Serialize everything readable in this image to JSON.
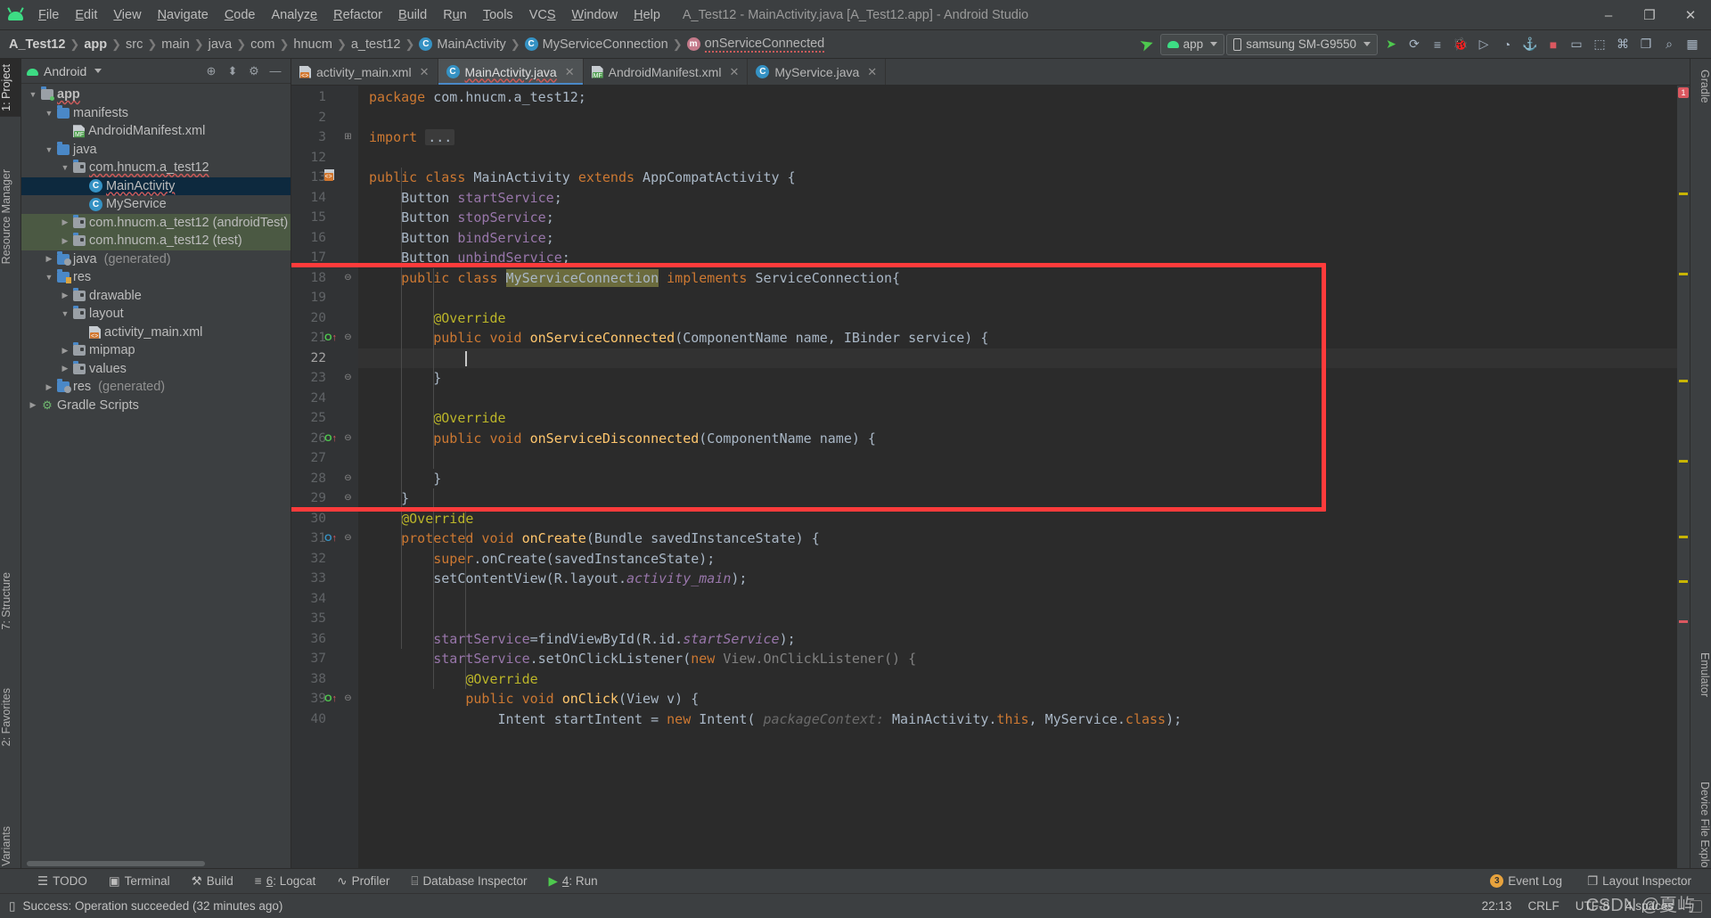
{
  "window": {
    "title": "A_Test12 - MainActivity.java [A_Test12.app] - Android Studio",
    "minimize": "–",
    "maximize": "❐",
    "close": "✕"
  },
  "menubar": {
    "items": [
      "File",
      "Edit",
      "View",
      "Navigate",
      "Code",
      "Analyze",
      "Refactor",
      "Build",
      "Run",
      "Tools",
      "VCS",
      "Window",
      "Help"
    ]
  },
  "breadcrumb": {
    "items": [
      {
        "label": "A_Test12",
        "bold": true,
        "icon": null
      },
      {
        "label": "app",
        "bold": true,
        "icon": null
      },
      {
        "label": "src",
        "bold": false,
        "icon": null
      },
      {
        "label": "main",
        "bold": false,
        "icon": null
      },
      {
        "label": "java",
        "bold": false,
        "icon": null
      },
      {
        "label": "com",
        "bold": false,
        "icon": null
      },
      {
        "label": "hnucm",
        "bold": false,
        "icon": null
      },
      {
        "label": "a_test12",
        "bold": false,
        "icon": null
      },
      {
        "label": "MainActivity",
        "bold": false,
        "icon": "class-badge"
      },
      {
        "label": "MyServiceConnection",
        "bold": false,
        "icon": "class-badge"
      },
      {
        "label": "onServiceConnected",
        "bold": false,
        "icon": "method-badge",
        "error": true
      }
    ],
    "separator": "❯"
  },
  "run_toolbar": {
    "config_label": "app",
    "device_label": "samsung SM-G9550",
    "icons": [
      {
        "name": "run-icon",
        "glyph": "➤"
      },
      {
        "name": "debug-attach-icon",
        "glyph": "⟳"
      },
      {
        "name": "apply-changes-icon",
        "glyph": "≡"
      },
      {
        "name": "debug-icon",
        "glyph": "🐞"
      },
      {
        "name": "run-to-cursor-icon",
        "glyph": "▷"
      },
      {
        "name": "profiler-icon",
        "glyph": "◔"
      },
      {
        "name": "attach-debugger-icon",
        "glyph": "⚓"
      },
      {
        "name": "stop-icon",
        "glyph": "■"
      },
      {
        "name": "avd-manager-icon",
        "glyph": "▭"
      },
      {
        "name": "sdk-manager-icon",
        "glyph": "⬚"
      },
      {
        "name": "device-file-explorer-icon",
        "glyph": "⌘"
      },
      {
        "name": "layout-inspector-icon",
        "glyph": "❐"
      },
      {
        "name": "search-icon",
        "glyph": "⌕"
      },
      {
        "name": "project-structure-icon",
        "glyph": "▦"
      }
    ],
    "sync_icon": "↻"
  },
  "left_tool_tabs": [
    {
      "label": "1: Project",
      "active": true
    },
    {
      "label": "Resource Manager",
      "active": false
    },
    {
      "label": "7: Structure",
      "active": false
    },
    {
      "label": "2: Favorites",
      "active": false
    },
    {
      "label": "Build Variants",
      "active": false
    }
  ],
  "right_tool_tabs": [
    {
      "label": "Gradle"
    },
    {
      "label": "Emulator"
    },
    {
      "label": "Device File Explorer"
    }
  ],
  "project_panel": {
    "scope_label": "Android",
    "header_icons": [
      {
        "name": "locate-icon",
        "glyph": "⊕"
      },
      {
        "name": "collapse-all-icon",
        "glyph": "⬍"
      },
      {
        "name": "settings-gear-icon",
        "glyph": "⚙"
      },
      {
        "name": "hide-panel-icon",
        "glyph": "—"
      }
    ],
    "tree": [
      {
        "label": "app",
        "indent": 0,
        "twist": "▼",
        "icon": "module-folder",
        "bold": true,
        "spell": true
      },
      {
        "label": "manifests",
        "indent": 1,
        "twist": "▼",
        "icon": "folder"
      },
      {
        "label": "AndroidManifest.xml",
        "indent": 2,
        "twist": "",
        "icon": "xml-manifest"
      },
      {
        "label": "java",
        "indent": 1,
        "twist": "▼",
        "icon": "folder"
      },
      {
        "label": "com.hnucm.a_test12",
        "indent": 2,
        "twist": "▼",
        "icon": "package",
        "spell": true
      },
      {
        "label": "MainActivity",
        "indent": 3,
        "twist": "",
        "icon": "class",
        "selected": true,
        "spell": true
      },
      {
        "label": "MyService",
        "indent": 3,
        "twist": "",
        "icon": "class"
      },
      {
        "label": "com.hnucm.a_test12 (androidTest)",
        "indent": 2,
        "twist": "▶",
        "icon": "package",
        "scope": "test"
      },
      {
        "label": "com.hnucm.a_test12 (test)",
        "indent": 2,
        "twist": "▶",
        "icon": "package",
        "scope": "test"
      },
      {
        "label": "java (generated)",
        "indent": 1,
        "twist": "▶",
        "icon": "folder-generated",
        "gray_suffix": "(generated)"
      },
      {
        "label": "res",
        "indent": 1,
        "twist": "▼",
        "icon": "folder-res"
      },
      {
        "label": "drawable",
        "indent": 2,
        "twist": "▶",
        "icon": "package"
      },
      {
        "label": "layout",
        "indent": 2,
        "twist": "▼",
        "icon": "package"
      },
      {
        "label": "activity_main.xml",
        "indent": 3,
        "twist": "",
        "icon": "xml-layout"
      },
      {
        "label": "mipmap",
        "indent": 2,
        "twist": "▶",
        "icon": "package"
      },
      {
        "label": "values",
        "indent": 2,
        "twist": "▶",
        "icon": "package"
      },
      {
        "label": "res (generated)",
        "indent": 1,
        "twist": "▶",
        "icon": "folder-generated",
        "gray_suffix": "(generated)"
      },
      {
        "label": "Gradle Scripts",
        "indent": 0,
        "twist": "▶",
        "icon": "gradle"
      }
    ]
  },
  "editor_tabs": [
    {
      "label": "activity_main.xml",
      "icon": "xml-layout-icon",
      "active": false,
      "close": "✕"
    },
    {
      "label": "MainActivity.java",
      "icon": "class-icon",
      "active": true,
      "close": "✕",
      "error": true
    },
    {
      "label": "AndroidManifest.xml",
      "icon": "xml-manifest-icon",
      "active": false,
      "close": "✕"
    },
    {
      "label": "MyService.java",
      "icon": "class-icon",
      "active": false,
      "close": "✕"
    }
  ],
  "editor": {
    "file": "MainActivity.java",
    "caret_line": 22,
    "error_count_badge": "1",
    "lines": [
      {
        "num": "1",
        "indent": 0,
        "html": "<span class=\"k\">package</span> com.hnucm.a_test12;"
      },
      {
        "num": "2",
        "indent": 0,
        "html": ""
      },
      {
        "num": "3",
        "indent": 0,
        "html": "<span class=\"k\">import</span> <span class=\"folded\">...</span>",
        "fold": "⊞"
      },
      {
        "num": "12",
        "indent": 0,
        "html": ""
      },
      {
        "num": "13",
        "indent": 0,
        "html": "<span class=\"k\">public class</span> MainActivity <span class=\"k\">extends</span> AppCompatActivity {",
        "gmark": "layout"
      },
      {
        "num": "14",
        "indent": 1,
        "html": "    Button <span class=\"fi\">startService</span>;"
      },
      {
        "num": "15",
        "indent": 1,
        "html": "    Button <span class=\"fi\">stopService</span>;"
      },
      {
        "num": "16",
        "indent": 1,
        "html": "    Button <span class=\"fi\">bindService</span>;"
      },
      {
        "num": "17",
        "indent": 1,
        "html": "    Button <span class=\"fi\">unbindService</span>;"
      },
      {
        "num": "18",
        "indent": 1,
        "html": "    <span class=\"k\">public class</span> <span class=\"ident-hl\">MyServiceConnection</span> <span class=\"k\">implements</span> ServiceConnection{",
        "fold": "⊖"
      },
      {
        "num": "19",
        "indent": 1,
        "html": ""
      },
      {
        "num": "20",
        "indent": 2,
        "html": "        <span class=\"an\">@Override</span>"
      },
      {
        "num": "21",
        "indent": 2,
        "html": "        <span class=\"k\">public void</span> <span class=\"f\">onServiceConnected</span>(ComponentName name, IBinder service) {",
        "gmark": "override-green",
        "fold": "⊖"
      },
      {
        "num": "22",
        "indent": 3,
        "html": "",
        "current": true
      },
      {
        "num": "23",
        "indent": 2,
        "html": "        }",
        "fold": "⊖"
      },
      {
        "num": "24",
        "indent": 2,
        "html": ""
      },
      {
        "num": "25",
        "indent": 2,
        "html": "        <span class=\"an\">@Override</span>"
      },
      {
        "num": "26",
        "indent": 2,
        "html": "        <span class=\"k\">public void</span> <span class=\"f\">onServiceDisconnected</span>(ComponentName name) {",
        "gmark": "override-green",
        "fold": "⊖"
      },
      {
        "num": "27",
        "indent": 2,
        "html": ""
      },
      {
        "num": "28",
        "indent": 2,
        "html": "        }",
        "fold": "⊖"
      },
      {
        "num": "29",
        "indent": 1,
        "html": "    }",
        "fold": "⊖"
      },
      {
        "num": "30",
        "indent": 1,
        "html": "    <span class=\"an\">@Override</span>"
      },
      {
        "num": "31",
        "indent": 1,
        "html": "    <span class=\"k\">protected void</span> <span class=\"f\">onCreate</span>(Bundle savedInstanceState) {",
        "gmark": "override-blue",
        "fold": "⊖"
      },
      {
        "num": "32",
        "indent": 2,
        "html": "        <span class=\"k\">super</span>.onCreate(savedInstanceState);"
      },
      {
        "num": "33",
        "indent": 2,
        "html": "        setContentView(R.layout.<span class=\"fii\">activity_main</span>);"
      },
      {
        "num": "34",
        "indent": 2,
        "html": ""
      },
      {
        "num": "35",
        "indent": 2,
        "html": ""
      },
      {
        "num": "36",
        "indent": 2,
        "html": "        <span class=\"fi\">startService</span>=findViewById(R.id.<span class=\"fii\">startService</span>);"
      },
      {
        "num": "37",
        "indent": 2,
        "html": "        <span class=\"fi\">startService</span>.setOnClickListener(<span class=\"k\">new</span> <span class=\"cm\">View.OnClickListener() {</span>"
      },
      {
        "num": "38",
        "indent": 3,
        "html": "            <span class=\"an\">@Override</span>"
      },
      {
        "num": "39",
        "indent": 3,
        "html": "            <span class=\"k\">public void</span> <span class=\"f\">onClick</span>(View v) {",
        "gmark": "override-green",
        "fold": "⊖"
      },
      {
        "num": "40",
        "indent": 4,
        "html": "                Intent startIntent = <span class=\"k\">new</span> Intent( <span class=\"hint\">packageContext:</span> MainActivity.<span class=\"k\">this</span>, MyService.<span class=\"k\">class</span>);"
      }
    ]
  },
  "annotation": {
    "red_box_label": "highlight-rectangle"
  },
  "bottom_tools": {
    "items": [
      {
        "label": "TODO",
        "icon": "☰"
      },
      {
        "label": "Terminal",
        "icon": "▣"
      },
      {
        "label": "Build",
        "icon": "⚒"
      },
      {
        "label": "6: Logcat",
        "icon": "≡"
      },
      {
        "label": "Profiler",
        "icon": "∿"
      },
      {
        "label": "Database Inspector",
        "icon": "⌸"
      },
      {
        "label": "4: Run",
        "icon": "▶"
      }
    ],
    "right": [
      {
        "label": "Event Log",
        "badge": "3",
        "icon": null
      },
      {
        "label": "Layout Inspector",
        "badge": null,
        "icon": "❐"
      }
    ]
  },
  "statusbar": {
    "message": "Success: Operation succeeded (32 minutes ago)",
    "message_icon": "▯",
    "time": "22:13",
    "line_separator": "CRLF",
    "encoding": "UTF-8",
    "indent": "4 spaces",
    "watermark": "CSDN @夏屿"
  },
  "colors": {
    "accent_blue": "#4a88c7",
    "highlight_red": "#ff3b3b",
    "selection_blue": "#0d293e",
    "test_scope_green": "#4b5943",
    "editor_bg": "#2b2b2b",
    "chrome_bg": "#3c3f41"
  }
}
